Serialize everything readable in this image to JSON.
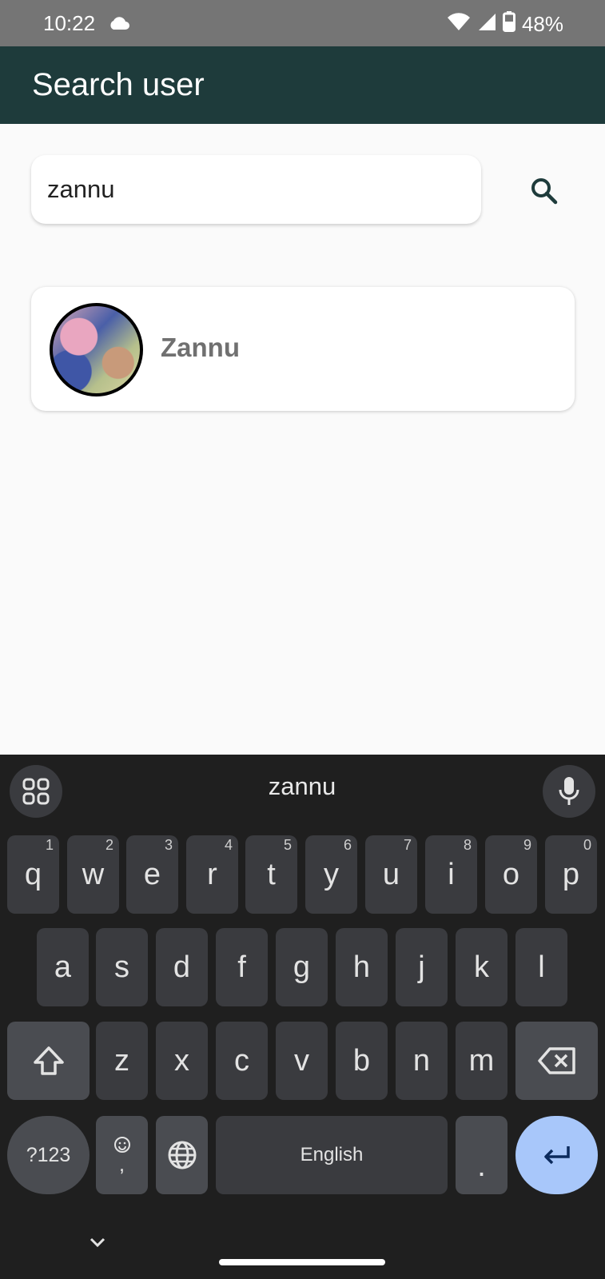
{
  "status_bar": {
    "time": "10:22",
    "battery": "48%",
    "icons": [
      "cloud-icon",
      "wifi-icon",
      "signal-icon",
      "battery-icon"
    ]
  },
  "app_bar": {
    "title": "Search user",
    "color": "#1e3b3b"
  },
  "search": {
    "value": "zannu",
    "placeholder": "",
    "button_icon": "search-icon"
  },
  "results": [
    {
      "name": "Zannu"
    }
  ],
  "keyboard": {
    "suggestion": "zannu",
    "row1": [
      {
        "k": "q",
        "h": "1"
      },
      {
        "k": "w",
        "h": "2"
      },
      {
        "k": "e",
        "h": "3"
      },
      {
        "k": "r",
        "h": "4"
      },
      {
        "k": "t",
        "h": "5"
      },
      {
        "k": "y",
        "h": "6"
      },
      {
        "k": "u",
        "h": "7"
      },
      {
        "k": "i",
        "h": "8"
      },
      {
        "k": "o",
        "h": "9"
      },
      {
        "k": "p",
        "h": "0"
      }
    ],
    "row2": [
      "a",
      "s",
      "d",
      "f",
      "g",
      "h",
      "j",
      "k",
      "l"
    ],
    "row3": [
      "z",
      "x",
      "c",
      "v",
      "b",
      "n",
      "m"
    ],
    "symbols_label": "?123",
    "comma": ",",
    "space_label": "English",
    "period": ".",
    "enter_color": "#a8c7fa"
  }
}
